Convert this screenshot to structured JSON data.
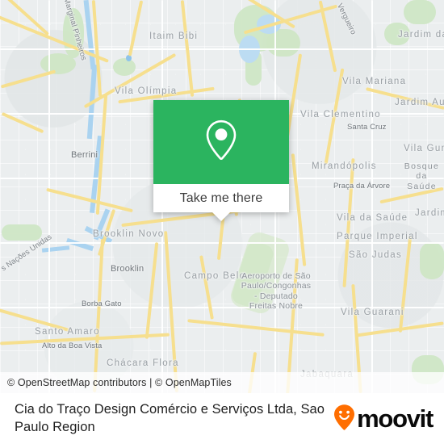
{
  "map": {
    "attribution": "© OpenStreetMap contributors | © OpenMapTiles",
    "labels": [
      {
        "text": "Marginal Pinheiros",
        "kind": "street-rot"
      },
      {
        "text": "Itaim Bibi",
        "kind": "area"
      },
      {
        "text": "Vila Olímpia",
        "kind": "area"
      },
      {
        "text": "Berrini",
        "kind": "area"
      },
      {
        "text": "Brooklin Novo",
        "kind": "area"
      },
      {
        "text": "Brooklin",
        "kind": "area"
      },
      {
        "text": "Borba Gato",
        "kind": "area"
      },
      {
        "text": "Santo Amaro",
        "kind": "area"
      },
      {
        "text": "Alto da Boa Vista",
        "kind": "area"
      },
      {
        "text": "Chácara Flora",
        "kind": "area"
      },
      {
        "text": "Campo Belo",
        "kind": "area"
      },
      {
        "text": "Nações Unidas",
        "kind": "street-rot"
      },
      {
        "text": "Vergueiro",
        "kind": "street-rot"
      },
      {
        "text": "Vila Mariana",
        "kind": "area"
      },
      {
        "text": "Vila Clementino",
        "kind": "area"
      },
      {
        "text": "Santa Cruz",
        "kind": "area"
      },
      {
        "text": "Mirandópolis",
        "kind": "area"
      },
      {
        "text": "Praça da Árvore",
        "kind": "area"
      },
      {
        "text": "Vila da Saúde",
        "kind": "area"
      },
      {
        "text": "Parque Imperial",
        "kind": "area"
      },
      {
        "text": "São Judas",
        "kind": "area"
      },
      {
        "text": "Vila Guarani",
        "kind": "area"
      },
      {
        "text": "Jabaquara",
        "kind": "area"
      },
      {
        "text": "Jardim da",
        "kind": "area"
      },
      {
        "text": "Jardim Auré",
        "kind": "area"
      },
      {
        "text": "Jardim",
        "kind": "area"
      },
      {
        "text": "Vila Gume",
        "kind": "area"
      },
      {
        "text": "Bosque\nda Saúde",
        "kind": "area"
      },
      {
        "text": "Aeroporto de São\nPaulo/Congonhas\n- Deputado\nFreitas Nobre",
        "kind": "poi"
      }
    ],
    "label_marginal_pinheiros": "Marginal Pinheiros",
    "label_itaim_bibi": "Itaim Bibi",
    "label_vila_olimpia": "Vila Olímpia",
    "label_berrini": "Berrini",
    "label_brooklin_novo": "Brooklin Novo",
    "label_brooklin": "Brooklin",
    "label_borba_gato": "Borba Gato",
    "label_santo_amaro": "Santo Amaro",
    "label_alto_da_boa_vista": "Alto da Boa Vista",
    "label_chacara_flora": "Chácara Flora",
    "label_campo_belo": "Campo Belo",
    "label_nacoes_unidas": "s Nações Unidas",
    "label_vergueiro": "Vergueiro",
    "label_vila_mariana": "Vila Mariana",
    "label_vila_clementino": "Vila Clementino",
    "label_santa_cruz": "Santa Cruz",
    "label_mirandopolis": "Mirandópolis",
    "label_praca_da_arvore": "Praça da Árvore",
    "label_vila_da_saude": "Vila da Saúde",
    "label_parque_imperial": "Parque Imperial",
    "label_sao_judas": "São Judas",
    "label_vila_guarani": "Vila Guarani",
    "label_jabaquara": "Jabaquara",
    "label_jardim_da": "Jardim da",
    "label_jardim_aure": "Jardim Auré",
    "label_jardim": "Jardim",
    "label_vila_gume": "Vila Gume",
    "label_bosque_da_saude": "Bosque\nda Saúde",
    "label_airport": "Aeroporto de São\nPaulo/Congonhas\n- Deputado\nFreitas Nobre"
  },
  "card": {
    "cta_label": "Take me there",
    "pin_icon": "map-pin-icon",
    "accent_color": "#2bb45f"
  },
  "footer": {
    "title": "Cia do Traço Design Comércio e Serviços Ltda, Sao Paulo Region",
    "brand_name": "moovit",
    "brand_icon": "moovit-smiley-pin-icon",
    "brand_color": "#ff6e00"
  }
}
